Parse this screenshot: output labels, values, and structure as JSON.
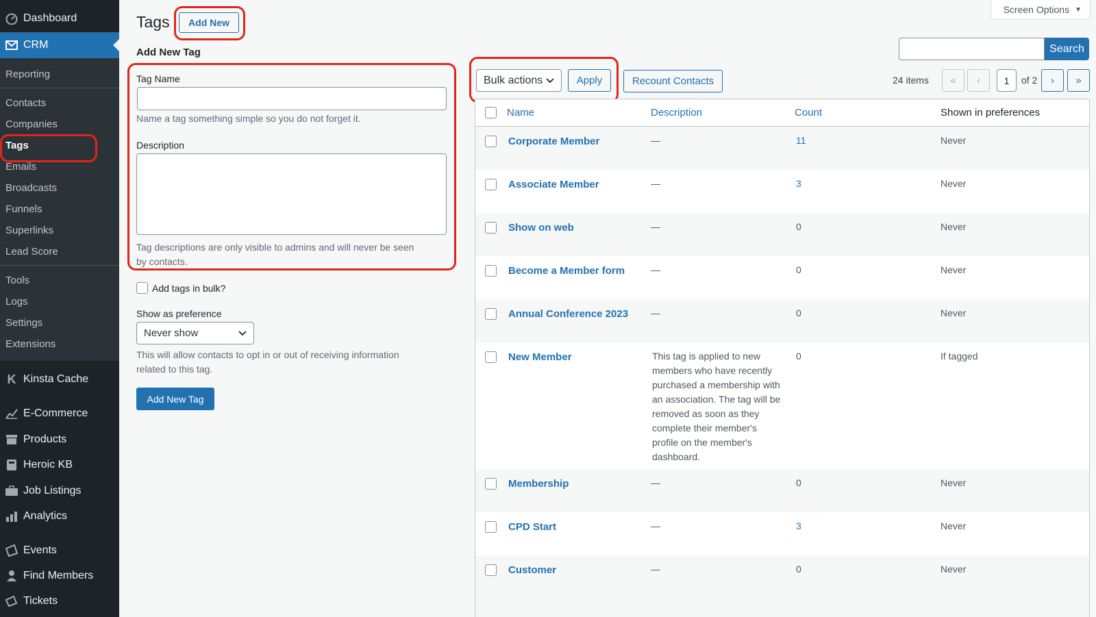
{
  "sidebar": {
    "dashboard": "Dashboard",
    "crm": "CRM",
    "submenu": [
      "Reporting",
      "Contacts",
      "Companies",
      "Tags",
      "Emails",
      "Broadcasts",
      "Funnels",
      "Superlinks",
      "Lead Score",
      "Tools",
      "Logs",
      "Settings",
      "Extensions"
    ],
    "current_submenu": "Tags",
    "menu": [
      "Kinsta Cache",
      "E-Commerce",
      "Products",
      "Heroic KB",
      "Job Listings",
      "Analytics",
      "Events",
      "Find Members",
      "Tickets"
    ]
  },
  "header": {
    "screen_options": "Screen Options",
    "title": "Tags",
    "add_new": "Add New"
  },
  "form": {
    "heading": "Add New Tag",
    "tag_name_label": "Tag Name",
    "tag_name_value": "",
    "tag_name_help": "Name a tag something simple so you do not forget it.",
    "description_label": "Description",
    "description_value": "",
    "description_help_1": "Tag descriptions are only visible to admins and will never be seen",
    "description_help_2": "by contacts.",
    "bulk_label": "Add tags in bulk?",
    "pref_label": "Show as preference",
    "pref_value": "Never show",
    "pref_help_1": "This will allow contacts to opt in or out of receiving information",
    "pref_help_2": "related to this tag.",
    "submit": "Add New Tag"
  },
  "search": {
    "value": "",
    "button": "Search"
  },
  "toolbar": {
    "bulk_actions": "Bulk actions",
    "apply": "Apply",
    "recount": "Recount Contacts",
    "items": "24 items",
    "page": "1",
    "of": "of 2",
    "first": "«",
    "prev": "‹",
    "next": "›",
    "last": "»"
  },
  "table": {
    "columns": [
      "Name",
      "Description",
      "Count",
      "Shown in preferences"
    ],
    "rows": [
      {
        "name": "Corporate Member",
        "description": "—",
        "count": "11",
        "pref": "Never"
      },
      {
        "name": "Associate Member",
        "description": "—",
        "count": "3",
        "pref": "Never"
      },
      {
        "name": "Show on web",
        "description": "—",
        "count": "0",
        "pref": "Never"
      },
      {
        "name": "Become a Member form",
        "description": "—",
        "count": "0",
        "pref": "Never"
      },
      {
        "name": "Annual Conference 2023",
        "description": "—",
        "count": "0",
        "pref": "Never"
      },
      {
        "name": "New Member",
        "description": "This tag is applied to new members who have recently purchased a membership with an association. The tag will be removed as soon as they complete their member's profile on the member's dashboard.",
        "count": "0",
        "pref": "If tagged"
      },
      {
        "name": "Membership",
        "description": "—",
        "count": "0",
        "pref": "Never"
      },
      {
        "name": "CPD Start",
        "description": "—",
        "count": "3",
        "pref": "Never"
      },
      {
        "name": "Customer",
        "description": "—",
        "count": "0",
        "pref": "Never"
      }
    ]
  },
  "colors": {
    "sidebar_bg": "#1d2327",
    "accent": "#2271b1",
    "highlight": "#e0261b"
  }
}
